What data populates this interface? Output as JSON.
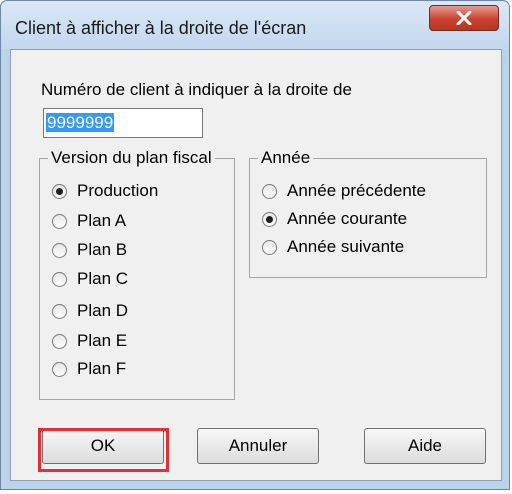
{
  "window": {
    "title": "Client à afficher à la droite de l'écran"
  },
  "client_number": {
    "label": "Numéro de client à indiquer à la droite de",
    "value": "9999999"
  },
  "plan_group": {
    "legend": "Version du plan fiscal",
    "options": [
      {
        "label": "Production",
        "checked": true
      },
      {
        "label": "Plan A",
        "checked": false
      },
      {
        "label": "Plan B",
        "checked": false
      },
      {
        "label": "Plan C",
        "checked": false
      },
      {
        "label": "Plan D",
        "checked": false
      },
      {
        "label": "Plan E",
        "checked": false
      },
      {
        "label": "Plan F",
        "checked": false
      }
    ]
  },
  "year_group": {
    "legend": "Année",
    "options": [
      {
        "label": "Année précédente",
        "checked": false
      },
      {
        "label": "Année courante",
        "checked": true
      },
      {
        "label": "Année suivante",
        "checked": false
      }
    ]
  },
  "buttons": {
    "ok": "OK",
    "cancel": "Annuler",
    "help": "Aide"
  },
  "colors": {
    "highlight": "#e0332f",
    "selection": "#3399ff"
  }
}
